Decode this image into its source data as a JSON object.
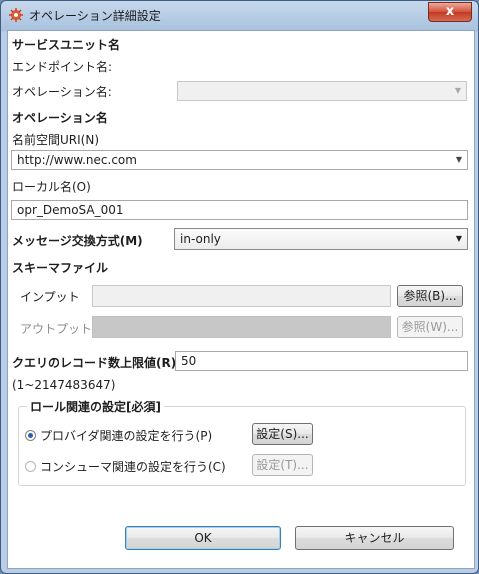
{
  "window": {
    "title": "オペレーション詳細設定",
    "close_label": "x"
  },
  "service_unit": {
    "heading": "サービスユニット名",
    "endpoint_label": "エンドポイント名:",
    "operation_label": "オペレーション名:",
    "operation_value": ""
  },
  "operation": {
    "heading": "オペレーション名",
    "namespace_label": "名前空間URI(N)",
    "namespace_value": "http://www.nec.com",
    "local_label": "ローカル名(O)",
    "local_value": "opr_DemoSA_001",
    "mep_label": "メッセージ交換方式(M)",
    "mep_value": "in-only"
  },
  "schema": {
    "heading": "スキーマファイル",
    "input_label": "インプット",
    "input_value": "",
    "input_browse": "参照(B)...",
    "output_label": "アウトプット",
    "output_value": "",
    "output_browse": "参照(W)..."
  },
  "query": {
    "label": "クエリのレコード数上限値(R)",
    "value": "50",
    "range": "(1~2147483647)"
  },
  "role": {
    "heading": "ロール関連の設定[必須]",
    "provider_label": "プロバイダ関連の設定を行う(P)",
    "provider_button": "設定(S)...",
    "consumer_label": "コンシューマ関連の設定を行う(C)",
    "consumer_button": "設定(T)..."
  },
  "footer": {
    "ok": "OK",
    "cancel": "キャンセル"
  }
}
